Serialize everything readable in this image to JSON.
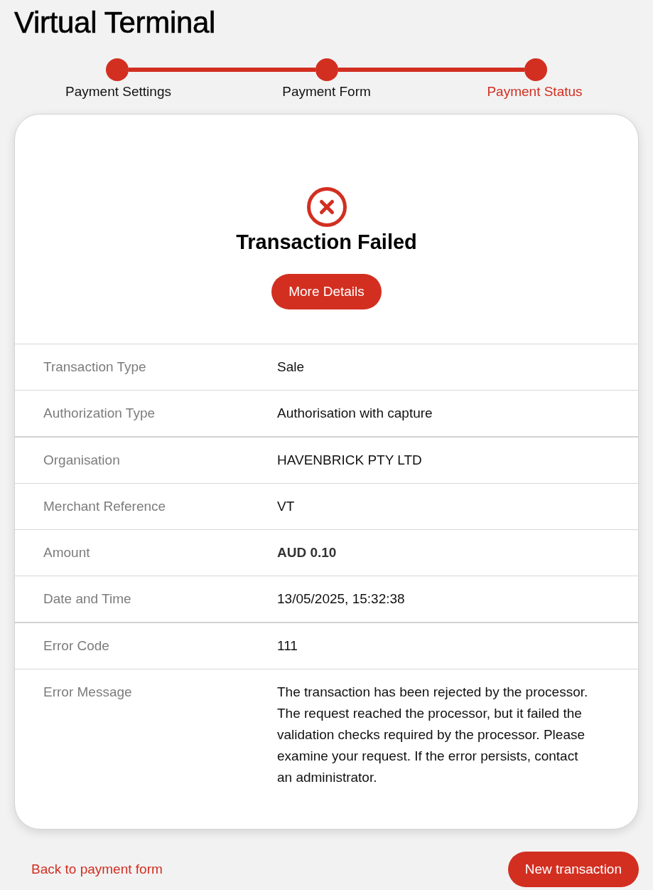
{
  "page": {
    "title": "Virtual Terminal"
  },
  "stepper": {
    "steps": [
      {
        "label": "Payment Settings",
        "selected": false
      },
      {
        "label": "Payment Form",
        "selected": false
      },
      {
        "label": "Payment Status",
        "selected": true
      }
    ]
  },
  "result": {
    "kind": "failed",
    "title": "Transaction Failed",
    "button": "More Details"
  },
  "details": {
    "sections": [
      {
        "rows": [
          {
            "label": "Transaction Type",
            "value": "Sale",
            "emphasized": false
          },
          {
            "label": "Authorization Type",
            "value": "Authorisation with capture",
            "emphasized": false
          }
        ]
      },
      {
        "rows": [
          {
            "label": "Organisation",
            "value": "HAVENBRICK PTY LTD",
            "emphasized": false
          },
          {
            "label": "Merchant Reference",
            "value": "VT",
            "emphasized": false
          },
          {
            "label": "Amount",
            "value": "AUD 0.10",
            "emphasized": true
          },
          {
            "label": "Date and Time",
            "value": "13/05/2025, 15:32:38",
            "emphasized": false
          }
        ]
      },
      {
        "rows": [
          {
            "label": "Error Code",
            "value": "111",
            "emphasized": false
          },
          {
            "label": "Error Message",
            "value": "The transaction has been rejected by the processor. The request reached the processor, but it failed the validation checks required by the processor. Please examine your request. If the error persists, contact an administrator.",
            "emphasized": false
          }
        ]
      }
    ]
  },
  "footer": {
    "back_link": "Back to payment form",
    "primary_button": "New transaction"
  }
}
